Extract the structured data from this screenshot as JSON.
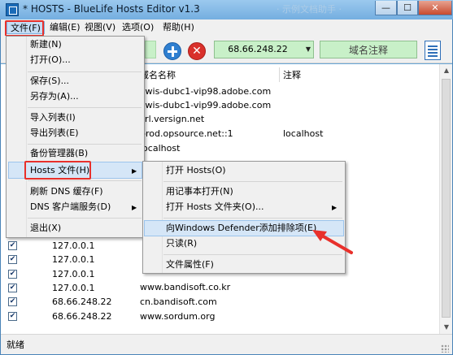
{
  "window": {
    "title": "* HOSTS - BlueLife Hosts Editor v1.3",
    "ghost_title": "· 示例文档助手 ·",
    "min_glyph": "—",
    "max_glyph": "☐",
    "close_glyph": "✕"
  },
  "menubar": {
    "file": "文件(F)",
    "edit": "编辑(E)",
    "view": "视图(V)",
    "options": "选项(O)",
    "help": "帮助(H)"
  },
  "toolbar": {
    "ip_value": "68.66.248.22",
    "comment_placeholder": "域名注释",
    "delete_glyph": "✕",
    "combo_arrow_glyph": "▼"
  },
  "list": {
    "columns": [
      "域名名称",
      "注释"
    ],
    "top_rows": [
      {
        "host": "vwis-dubc1-vip98.adobe.com",
        "comment": ""
      },
      {
        "host": "vwis-dubc1-vip99.adobe.com",
        "comment": ""
      },
      {
        "host": "crl.versign.net",
        "comment": ""
      },
      {
        "host": "prod.opsource.net::1",
        "comment": "localhost"
      },
      {
        "host": "localhost",
        "comment": ""
      },
      {
        "host": "l",
        "comment": ""
      }
    ],
    "rows": [
      {
        "ip": "127.0.0.1",
        "host": "",
        "checked": true
      },
      {
        "ip": "127.0.0.1",
        "host": "",
        "checked": true
      },
      {
        "ip": "127.0.0.1",
        "host": "www.bandisoft.co.kr",
        "checked": true
      },
      {
        "ip": "127.0.0.1",
        "host": "cn.bandisoft.com",
        "checked": true
      },
      {
        "ip": "68.66.248.22",
        "host": "www.sordum.org",
        "checked": true
      }
    ],
    "check_glyph": "✔"
  },
  "status": {
    "text": "就绪"
  },
  "file_menu": {
    "items": [
      {
        "label": "新建(N)"
      },
      {
        "label": "打开(O)..."
      },
      {
        "label": "保存(S)..."
      },
      {
        "label": "另存为(A)..."
      },
      {
        "label": "导入列表(I)"
      },
      {
        "label": "导出列表(E)"
      },
      {
        "label": "备份管理器(B)"
      },
      {
        "label": "Hosts 文件(H)"
      },
      {
        "label": "刷新 DNS 缓存(F)"
      },
      {
        "label": "DNS 客户端服务(D)"
      },
      {
        "label": "退出(X)"
      }
    ],
    "submenu_arrow": "▶"
  },
  "hosts_submenu": {
    "items": [
      {
        "label": "打开 Hosts(O)"
      },
      {
        "label": "用记事本打开(N)"
      },
      {
        "label": "打开 Hosts 文件夹(O)..."
      },
      {
        "label": "向Windows Defender添加排除项(E)"
      },
      {
        "label": "只读(R)"
      },
      {
        "label": "文件属性(F)"
      }
    ]
  },
  "colors": {
    "highlight_border": "#e8302b",
    "toolbar_green": "#c8f0c8",
    "add_blue": "#2f7fd0",
    "delete_red": "#d9302b"
  }
}
